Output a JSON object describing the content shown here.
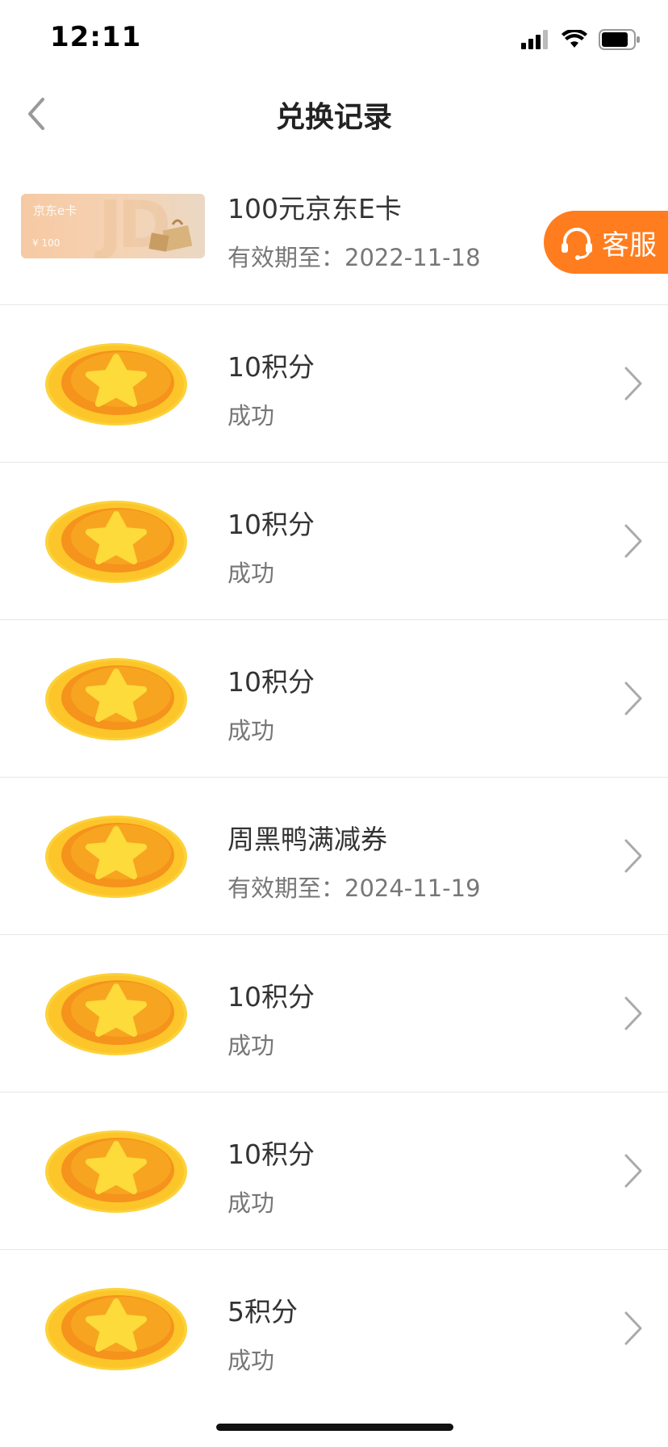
{
  "status_bar": {
    "time": "12:11"
  },
  "header": {
    "title": "兑换记录"
  },
  "service": {
    "label": "客服"
  },
  "records": [
    {
      "title": "100元京东E卡",
      "sub": "有效期至：2022-11-18",
      "card_label": "京东e卡",
      "card_price": "¥ 100",
      "card_brand": "JD"
    },
    {
      "title": "10积分",
      "sub": "成功"
    },
    {
      "title": "10积分",
      "sub": "成功"
    },
    {
      "title": "10积分",
      "sub": "成功"
    },
    {
      "title": "周黑鸭满减券",
      "sub": "有效期至：2024-11-19"
    },
    {
      "title": "10积分",
      "sub": "成功"
    },
    {
      "title": "10积分",
      "sub": "成功"
    },
    {
      "title": "5积分",
      "sub": "成功"
    }
  ],
  "colors": {
    "accent": "#ff7d1f",
    "coin_outer": "#fcc52a",
    "coin_inner": "#f5931c",
    "star": "#fddb3a"
  }
}
